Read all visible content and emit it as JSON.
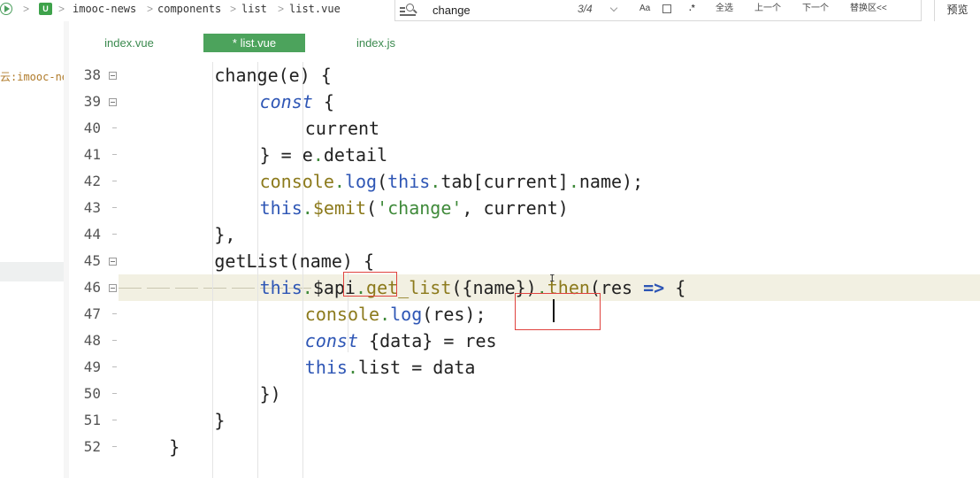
{
  "topbar": {
    "project_icon": "project-icon",
    "breadcrumb": [
      "imooc-news",
      "components",
      "list",
      "list.vue"
    ],
    "search_value": "change",
    "match_count": "3/4",
    "options": {
      "match_case": "Aa",
      "word": "Ab",
      "regex": ".*",
      "select_all": "全选",
      "prev": "上一个",
      "next": "下一个",
      "replace_toggle": "替换区<<"
    },
    "preview": "预览"
  },
  "explorer": {
    "project_label": "云:imooc-news"
  },
  "tabs": [
    {
      "label": "index.vue",
      "active": false
    },
    {
      "label": "* list.vue",
      "active": true
    },
    {
      "label": "index.js",
      "active": false
    }
  ],
  "editor": {
    "current_line": 46,
    "line_numbers": [
      "38",
      "39",
      "40",
      "41",
      "42",
      "43",
      "44",
      "45",
      "46",
      "47",
      "48",
      "49",
      "50",
      "51",
      "52"
    ],
    "folds": [
      "38",
      "39",
      "45",
      "46"
    ],
    "lines": [
      {
        "indent": 2,
        "tokens": [
          {
            "t": "change(e) {",
            "c": "plain"
          }
        ]
      },
      {
        "indent": 3,
        "tokens": [
          {
            "t": "const",
            "c": "kwi"
          },
          {
            "t": " {",
            "c": "plain"
          }
        ]
      },
      {
        "indent": 4,
        "tokens": [
          {
            "t": "current",
            "c": "plain"
          }
        ]
      },
      {
        "indent": 3,
        "tokens": [
          {
            "t": "} = e",
            "c": "plain"
          },
          {
            "t": ".",
            "c": "op"
          },
          {
            "t": "detail",
            "c": "plain"
          }
        ]
      },
      {
        "indent": 3,
        "tokens": [
          {
            "t": "console",
            "c": "fn"
          },
          {
            "t": ".",
            "c": "op"
          },
          {
            "t": "log",
            "c": "kw"
          },
          {
            "t": "(",
            "c": "plain"
          },
          {
            "t": "this",
            "c": "kw"
          },
          {
            "t": ".",
            "c": "op"
          },
          {
            "t": "tab[current]",
            "c": "plain"
          },
          {
            "t": ".",
            "c": "op"
          },
          {
            "t": "name);",
            "c": "plain"
          }
        ]
      },
      {
        "indent": 3,
        "tokens": [
          {
            "t": "this",
            "c": "kw"
          },
          {
            "t": ".",
            "c": "op"
          },
          {
            "t": "$emit",
            "c": "fn"
          },
          {
            "t": "(",
            "c": "plain"
          },
          {
            "t": "'change'",
            "c": "str"
          },
          {
            "t": ", current)",
            "c": "plain"
          }
        ]
      },
      {
        "indent": 2,
        "tokens": [
          {
            "t": "},",
            "c": "plain"
          }
        ]
      },
      {
        "indent": 2,
        "tokens": [
          {
            "t": "getList(name) {",
            "c": "plain"
          }
        ]
      },
      {
        "indent": 3,
        "tokens": [
          {
            "t": "this",
            "c": "kw"
          },
          {
            "t": ".",
            "c": "op"
          },
          {
            "t": "$api",
            "c": "plain"
          },
          {
            "t": ".",
            "c": "op"
          },
          {
            "t": "get_list",
            "c": "fn"
          },
          {
            "t": "({name})",
            "c": "plain"
          },
          {
            "t": ".",
            "c": "op"
          },
          {
            "t": "then",
            "c": "fn"
          },
          {
            "t": "(res ",
            "c": "plain"
          },
          {
            "t": "=>",
            "c": "arrow"
          },
          {
            "t": " {",
            "c": "plain"
          }
        ]
      },
      {
        "indent": 4,
        "tokens": [
          {
            "t": "console",
            "c": "fn"
          },
          {
            "t": ".",
            "c": "op"
          },
          {
            "t": "log",
            "c": "kw"
          },
          {
            "t": "(res);",
            "c": "plain"
          }
        ]
      },
      {
        "indent": 4,
        "tokens": [
          {
            "t": "const",
            "c": "kwi"
          },
          {
            "t": " {data} = res",
            "c": "plain"
          }
        ]
      },
      {
        "indent": 4,
        "tokens": [
          {
            "t": "this",
            "c": "kw"
          },
          {
            "t": ".",
            "c": "op"
          },
          {
            "t": "list = data",
            "c": "plain"
          }
        ]
      },
      {
        "indent": 3,
        "tokens": [
          {
            "t": "})",
            "c": "plain"
          }
        ]
      },
      {
        "indent": 2,
        "tokens": [
          {
            "t": "}",
            "c": "plain"
          }
        ]
      },
      {
        "indent": 1,
        "tokens": [
          {
            "t": "}",
            "c": "plain"
          }
        ]
      }
    ]
  },
  "colors": {
    "accent_green": "#4ca35c",
    "keyword_blue": "#2e56b5",
    "function_olive": "#8c7a1c",
    "string_green": "#3f8a3a",
    "annotation_red": "#e0433f",
    "current_line_bg": "#f2f0e2"
  }
}
